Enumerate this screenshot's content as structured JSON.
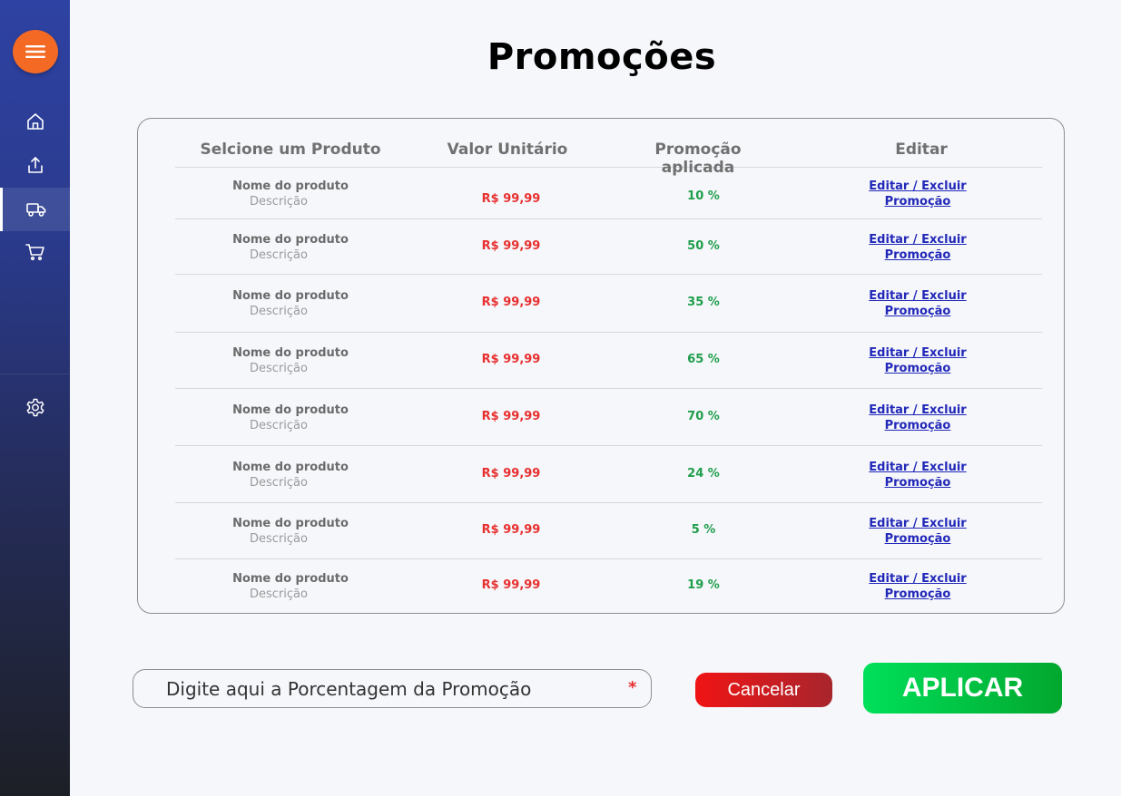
{
  "title": "Promoções",
  "table": {
    "headers": [
      "Selcione um Produto",
      "Valor Unitário",
      "Promoção aplicada",
      "Editar"
    ],
    "rows": [
      {
        "name": "Nome do produto",
        "desc": "Descrição",
        "price": "R$ 99,99",
        "promo": "10 %",
        "edit1": "Editar / Excluir",
        "edit2": "Promoção"
      },
      {
        "name": "Nome do produto",
        "desc": "Descrição",
        "price": "R$ 99,99",
        "promo": "50 %",
        "edit1": "Editar / Excluir",
        "edit2": "Promoção"
      },
      {
        "name": "Nome do produto",
        "desc": "Descrição",
        "price": "R$ 99,99",
        "promo": "35 %",
        "edit1": "Editar / Excluir",
        "edit2": "Promoção"
      },
      {
        "name": "Nome do produto",
        "desc": "Descrição",
        "price": "R$ 99,99",
        "promo": "65 %",
        "edit1": "Editar / Excluir",
        "edit2": "Promoção"
      },
      {
        "name": "Nome do produto",
        "desc": "Descrição",
        "price": "R$ 99,99",
        "promo": "70 %",
        "edit1": "Editar / Excluir",
        "edit2": "Promoção"
      },
      {
        "name": "Nome do produto",
        "desc": "Descrição",
        "price": "R$ 99,99",
        "promo": "24 %",
        "edit1": "Editar / Excluir",
        "edit2": "Promoção"
      },
      {
        "name": "Nome do produto",
        "desc": "Descrição",
        "price": "R$ 99,99",
        "promo": "5 %",
        "edit1": "Editar / Excluir",
        "edit2": "Promoção"
      },
      {
        "name": "Nome do produto",
        "desc": "Descrição",
        "price": "R$ 99,99",
        "promo": "19 %",
        "edit1": "Editar / Excluir",
        "edit2": "Promoção"
      }
    ]
  },
  "form": {
    "placeholder": "Digite aqui a Porcentagem da Promoção",
    "required_mark": "*",
    "cancel_label": "Cancelar",
    "apply_label": "APLICAR"
  },
  "sidebar": {
    "icons": [
      "menu-icon",
      "home-icon",
      "upload-icon",
      "truck-icon",
      "cart-icon",
      "gear-icon"
    ],
    "active": "truck-icon"
  },
  "colors": {
    "menu_button": "#f46a25",
    "price": "#e8302f",
    "promo": "#1f9e4a",
    "edit_link": "#2228b8",
    "apply": "#02c146",
    "cancel": "#e01818"
  }
}
